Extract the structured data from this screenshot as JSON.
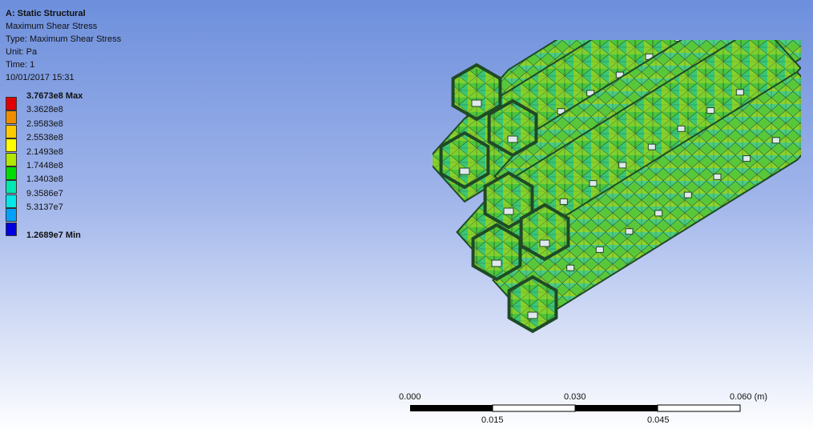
{
  "info": {
    "title": "A: Static Structural",
    "result_name": "Maximum Shear Stress",
    "type_line": "Type: Maximum Shear Stress",
    "unit_line": "Unit: Pa",
    "time_line": "Time: 1",
    "date_line": "10/01/2017 15:31"
  },
  "legend": {
    "entries": [
      {
        "label": "3.7673e8 Max",
        "color": "#e00000",
        "bold": true
      },
      {
        "label": "3.3628e8",
        "color": "#f08c00",
        "bold": false
      },
      {
        "label": "2.9583e8",
        "color": "#ffcc00",
        "bold": false
      },
      {
        "label": "2.5538e8",
        "color": "#ffff00",
        "bold": false
      },
      {
        "label": "2.1493e8",
        "color": "#b0e800",
        "bold": false
      },
      {
        "label": "1.7448e8",
        "color": "#00dd00",
        "bold": false
      },
      {
        "label": "1.3403e8",
        "color": "#00e8b0",
        "bold": false
      },
      {
        "label": "9.3586e7",
        "color": "#00e8e8",
        "bold": false
      },
      {
        "label": "5.3137e7",
        "color": "#00a0ff",
        "bold": false
      },
      {
        "label": "",
        "color": "#0000e0",
        "bold": false
      },
      {
        "label": "1.2689e7 Min",
        "color": "",
        "bold": true
      }
    ]
  },
  "scale_bar": {
    "top_labels": [
      "0.000",
      "0.030",
      "0.060 (m)"
    ],
    "bottom_labels": [
      "0.015",
      "0.045"
    ]
  },
  "colors": {
    "mesh_green": "#47c62e",
    "mesh_edge": "#1f4a25",
    "hole_fill": "#dfe8ec"
  }
}
